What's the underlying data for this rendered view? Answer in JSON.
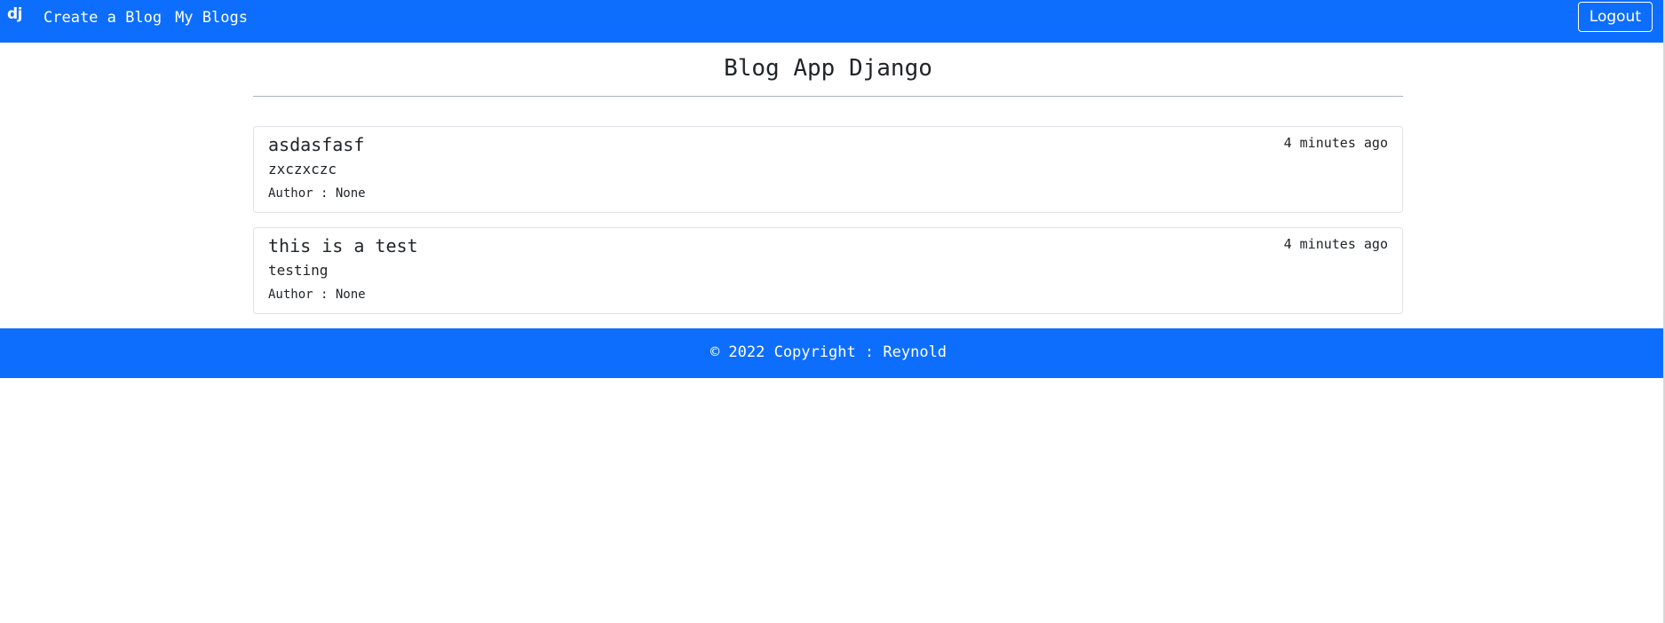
{
  "navbar": {
    "brand": "dj",
    "links": [
      "Create a Blog",
      "My Blogs"
    ],
    "logout_label": "Logout",
    "background": "#0d6efd"
  },
  "header": {
    "title": "Blog App Django"
  },
  "posts": [
    {
      "title": "asdasfasf",
      "time": "4 minutes ago",
      "body": "zxczxczc",
      "author": "Author : None"
    },
    {
      "title": "this is a test",
      "time": "4 minutes ago",
      "body": "testing",
      "author": "Author : None"
    }
  ],
  "footer": {
    "text": "© 2022 Copyright : Reynold"
  }
}
